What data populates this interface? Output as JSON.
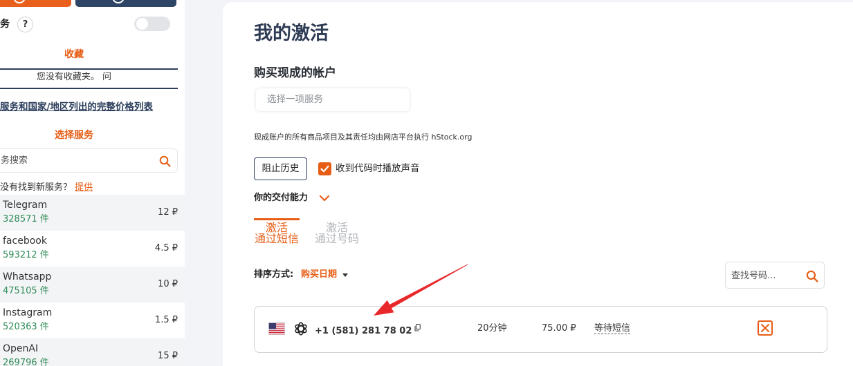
{
  "sidebar": {
    "service_toggle": {
      "label": "务",
      "help_label": "?",
      "on": false
    },
    "favorites": {
      "heading": "收藏",
      "empty_text": "您没有收藏夹。 问"
    },
    "price_list_link": "服务和国家/地区列出的完整价格列表",
    "select_service": {
      "heading": "选择服务",
      "search_placeholder": "务搜索"
    },
    "suggest": {
      "text": "没有找到新服务？ ",
      "link": "提供"
    },
    "services": [
      {
        "name": "Telegram",
        "count": "328571 件",
        "price": "12 ₽"
      },
      {
        "name": "facebook",
        "count": "593212 件",
        "price": "4.5 ₽"
      },
      {
        "name": "Whatsapp",
        "count": "475105 件",
        "price": "10 ₽"
      },
      {
        "name": "Instagram",
        "count": "520363 件",
        "price": "1.5 ₽"
      },
      {
        "name": "OpenAI",
        "count": "269796 件",
        "price": "15 ₽"
      }
    ]
  },
  "main": {
    "title": "我的激活",
    "ready_accounts": {
      "heading": "购买现成的帐户",
      "select_placeholder": "选择一项服务",
      "disclaimer": "现成账户的所有商品项目及其责任均由网店平台执行 hStock.org"
    },
    "block_history_button": "阻止历史",
    "sound_checkbox": {
      "label": "收到代码时播放声音",
      "checked": true
    },
    "delivery_capability": "你的交付能力",
    "tabs": [
      {
        "line1": "激活",
        "line2": "通过短信",
        "active": true
      },
      {
        "line1": "激活",
        "line2": "通过号码",
        "active": false
      }
    ],
    "sort": {
      "label": "排序方式:",
      "value": "购买日期"
    },
    "number_search_placeholder": "查找号码...",
    "activations": [
      {
        "country_icon": "us-flag-icon",
        "service_icon": "openai-icon",
        "phone": "+1 (581) 281 78 02",
        "time": "20分钟",
        "price": "75.00 ₽",
        "status": "等待短信"
      }
    ]
  },
  "colors": {
    "accent": "#e75d15",
    "navy": "#2c3e5c",
    "count_green": "#2e8b57",
    "annotation_red": "#e8282b"
  }
}
